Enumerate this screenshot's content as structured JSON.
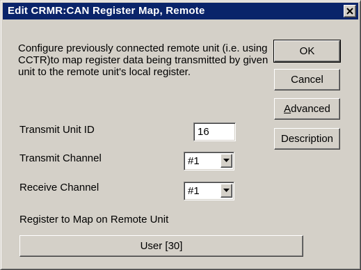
{
  "window": {
    "title": "Edit CRMR:CAN Register Map, Remote",
    "close_symbol": "✕"
  },
  "description": "Configure previously connected remote unit (i.e. using CCTR)to map register data being transmitted by given unit to the remote unit's local register.",
  "buttons": {
    "ok": "OK",
    "cancel": "Cancel",
    "advanced_prefix": "A",
    "advanced_rest": "dvanced",
    "description": "Description"
  },
  "transmit_unit": {
    "label": "Transmit Unit ID",
    "value": "16"
  },
  "transmit_channel": {
    "label": "Transmit Channel",
    "value": "#1"
  },
  "receive_channel": {
    "label": "Receive Channel",
    "value": "#1"
  },
  "register": {
    "label": "Register to Map on Remote Unit",
    "button": "User [30]"
  },
  "icons": {
    "close": "close-icon",
    "dropdown": "chevron-down-icon"
  },
  "colors": {
    "titlebar": "#0a246a",
    "face": "#d4d0c8"
  }
}
